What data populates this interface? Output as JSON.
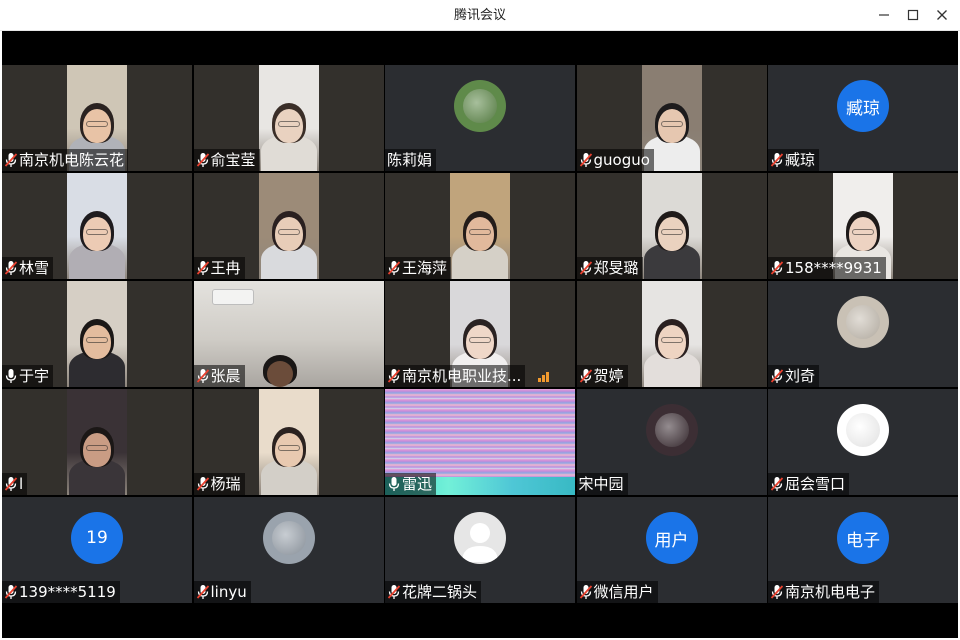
{
  "window": {
    "title": "腾讯会议",
    "minimize_icon": "minimize-icon",
    "maximize_icon": "maximize-icon",
    "close_icon": "close-icon"
  },
  "participants": [
    {
      "name": "南京机电陈云花",
      "kind": "video",
      "mic": "muted",
      "skin": "#e8c3a6",
      "hair": "#2a2220",
      "shirt": "#b0b2b8",
      "bg": "#cfc6b6"
    },
    {
      "name": "俞宝莹",
      "kind": "video",
      "mic": "muted",
      "skin": "#e9d2c0",
      "hair": "#3a2e28",
      "shirt": "#e0dcd6",
      "bg": "#e8e6e3"
    },
    {
      "name": "陈莉娟",
      "kind": "avatar-photo",
      "mic": "none",
      "avatar_color": "#5f8a4a"
    },
    {
      "name": "guoguo",
      "kind": "video",
      "mic": "muted",
      "skin": "#e6c7b0",
      "hair": "#1d1b1c",
      "shirt": "#ededed",
      "bg": "#8a7e72"
    },
    {
      "name": "臧琼",
      "kind": "avatar-initial",
      "mic": "muted",
      "initial": "臧琼"
    },
    {
      "name": "林雪",
      "kind": "video",
      "mic": "muted",
      "skin": "#eccbb4",
      "hair": "#1e1b1e",
      "shirt": "#b1aeb4",
      "bg": "#d9dde5"
    },
    {
      "name": "王冉",
      "kind": "video",
      "mic": "muted",
      "skin": "#e8cdb8",
      "hair": "#2a2020",
      "shirt": "#d9dadd",
      "bg": "#9c8b78"
    },
    {
      "name": "王海萍",
      "kind": "video",
      "mic": "muted",
      "skin": "#e1b99c",
      "hair": "#231c19",
      "shirt": "#d5d0c7",
      "bg": "#c0a47c"
    },
    {
      "name": "郑旻璐",
      "kind": "video",
      "mic": "muted",
      "skin": "#ead2bf",
      "hair": "#1f1a19",
      "shirt": "#3b3a3d",
      "bg": "#dcdad6"
    },
    {
      "name": "158****9931",
      "kind": "video",
      "mic": "muted",
      "skin": "#edd3c2",
      "hair": "#1e1a19",
      "shirt": "#e9e6e2",
      "bg": "#f0eeec"
    },
    {
      "name": "于宇",
      "kind": "video",
      "mic": "on",
      "skin": "#e3bc9e",
      "hair": "#1a1716",
      "shirt": "#2d2c30",
      "bg": "#d6cfc5"
    },
    {
      "name": "张晨",
      "kind": "video-wide",
      "mic": "muted",
      "skin": "#6b4c3a",
      "hair": "#1a1716",
      "shirt": "#2c2a2b",
      "bg": "#cdcbc7"
    },
    {
      "name": "南京机电职业技...",
      "kind": "video",
      "mic": "muted",
      "skin": "#efd7c8",
      "hair": "#2a2222",
      "shirt": "#f1efef",
      "bg": "#d9d8da",
      "signal": true
    },
    {
      "name": "贺婷",
      "kind": "video",
      "mic": "muted",
      "skin": "#eed4c2",
      "hair": "#2a2020",
      "shirt": "#e3dedb",
      "bg": "#e6e4e2"
    },
    {
      "name": "刘奇",
      "kind": "avatar-photo",
      "mic": "muted",
      "avatar_color": "#c9c1b5"
    },
    {
      "name": "l",
      "kind": "video",
      "mic": "muted",
      "skin": "#c99c84",
      "hair": "#1b1716",
      "shirt": "#3a3539",
      "bg": "#3a3236"
    },
    {
      "name": "杨瑞",
      "kind": "video",
      "mic": "muted",
      "skin": "#e8c9b0",
      "hair": "#2b2220",
      "shirt": "#d3cfc8",
      "bg": "#e9dccb"
    },
    {
      "name": "雷迅",
      "kind": "glitch",
      "mic": "on"
    },
    {
      "name": "宋中园",
      "kind": "avatar-photo",
      "mic": "none",
      "avatar_color": "#3c2e34"
    },
    {
      "name": "屈会雪口",
      "kind": "avatar-photo",
      "mic": "muted",
      "avatar_color": "#ffffff"
    },
    {
      "name": "139****5119",
      "kind": "avatar-initial",
      "mic": "muted",
      "initial": "19"
    },
    {
      "name": "linyu",
      "kind": "avatar-photo",
      "mic": "muted",
      "avatar_color": "#9aa3ad"
    },
    {
      "name": "花牌二锅头",
      "kind": "avatar-default",
      "mic": "muted"
    },
    {
      "name": "微信用户",
      "kind": "avatar-initial",
      "mic": "muted",
      "initial": "用户"
    },
    {
      "name": "南京机电电子",
      "kind": "avatar-initial",
      "mic": "muted",
      "initial": "电子"
    }
  ]
}
